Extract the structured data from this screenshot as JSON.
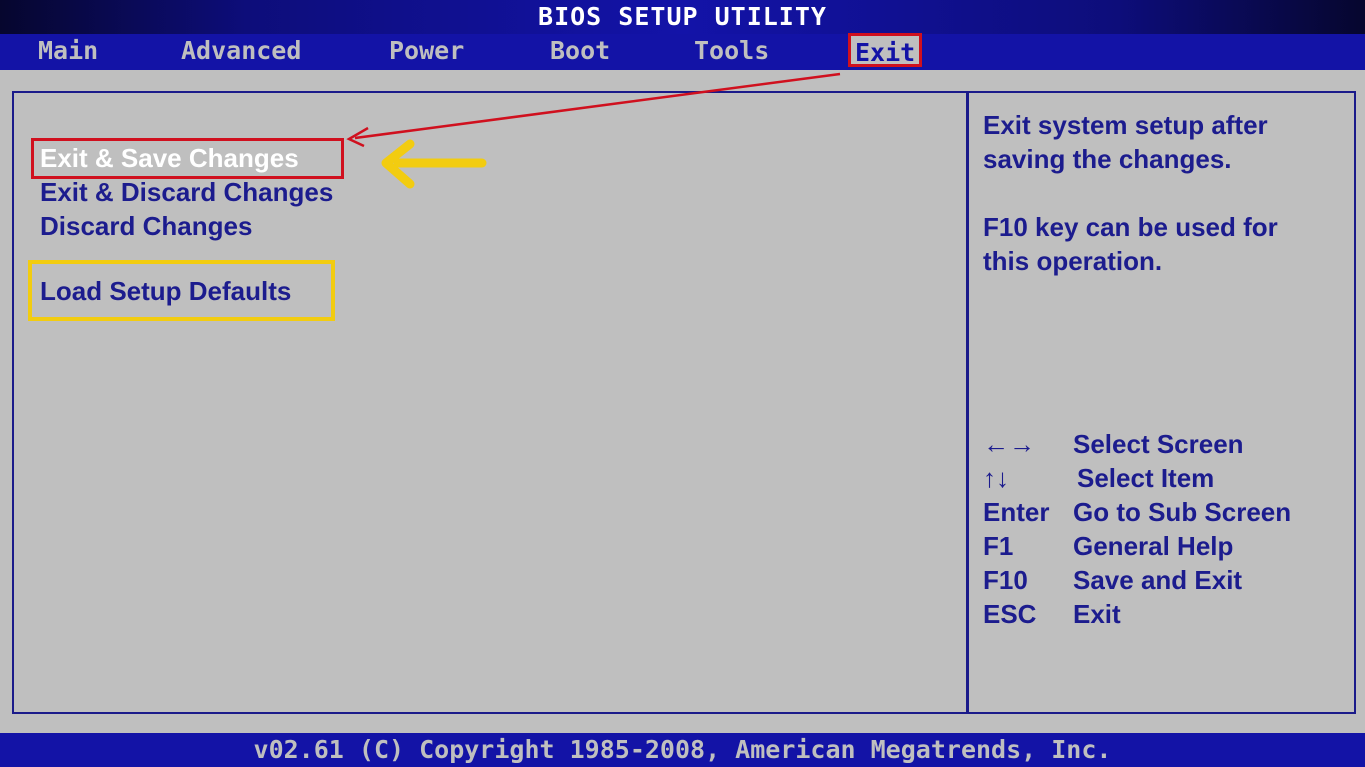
{
  "title": "BIOS SETUP UTILITY",
  "menu": {
    "items": [
      {
        "label": "Main"
      },
      {
        "label": "Advanced"
      },
      {
        "label": "Power"
      },
      {
        "label": "Boot"
      },
      {
        "label": "Tools"
      },
      {
        "label": "Exit"
      }
    ],
    "active": "Exit"
  },
  "options": [
    {
      "label": "Exit & Save Changes",
      "selected": true
    },
    {
      "label": "Exit & Discard Changes",
      "selected": false
    },
    {
      "label": "Discard Changes",
      "selected": false
    },
    {
      "label": "Load Setup Defaults",
      "selected": false
    }
  ],
  "help": {
    "description": [
      "Exit system setup after",
      "saving the changes."
    ],
    "note": [
      "F10 key can be used for",
      "this operation."
    ]
  },
  "keys": [
    {
      "key": "←→",
      "desc": "Select Screen"
    },
    {
      "key": "↑↓",
      "desc": "Select Item"
    },
    {
      "key": "Enter",
      "desc": "Go to Sub Screen"
    },
    {
      "key": "F1",
      "desc": "General Help"
    },
    {
      "key": "F10",
      "desc": "Save and Exit"
    },
    {
      "key": "ESC",
      "desc": "Exit"
    }
  ],
  "footer": "v02.61 (C) Copyright 1985-2008, American Megatrends, Inc.",
  "colors": {
    "bar_blue": "#1313a6",
    "panel_gray": "#bfbfbf",
    "text_blue": "#1c1c8e",
    "annotation_red": "#d0101e",
    "annotation_yellow": "#f2cc10"
  }
}
